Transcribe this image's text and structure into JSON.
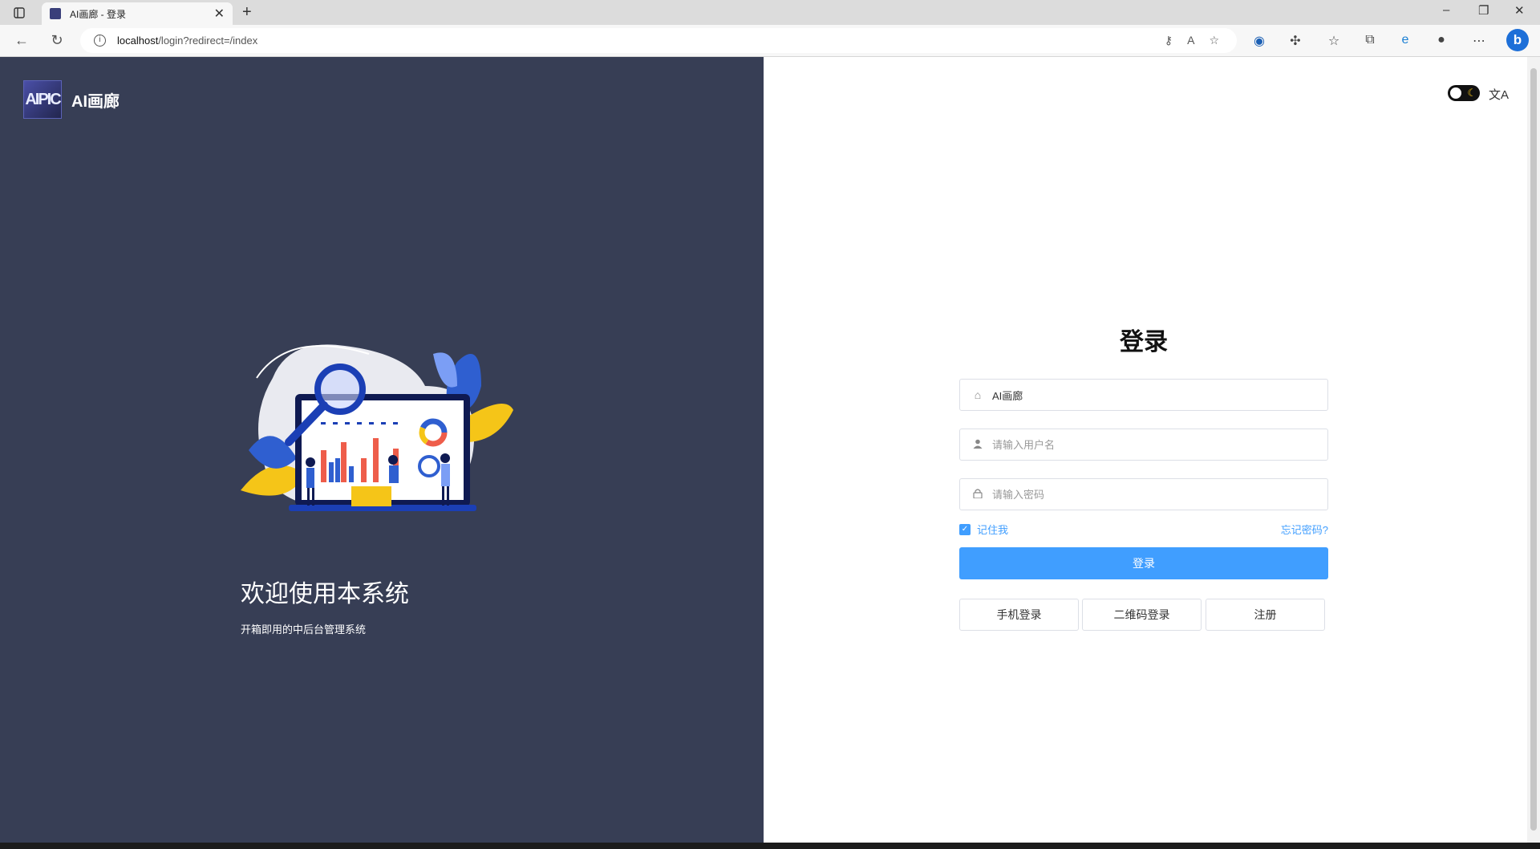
{
  "browser": {
    "tab_title": "AI画廊 - 登录",
    "url_host": "localhost",
    "url_path": "/login?redirect=/index"
  },
  "brand": {
    "logo_text": "AIPIC",
    "name": "AI画廊"
  },
  "left": {
    "welcome": "欢迎使用本系统",
    "subtitle": "开箱即用的中后台管理系统"
  },
  "login": {
    "title": "登录",
    "tenant_value": "AI画廊",
    "username_placeholder": "请输入用户名",
    "password_placeholder": "请输入密码",
    "remember_label": "记住我",
    "remember_checked": true,
    "forgot_label": "忘记密码?",
    "submit_label": "登录",
    "phone_login": "手机登录",
    "qrcode_login": "二维码登录",
    "register": "注册"
  },
  "colors": {
    "sidebar_bg": "#373e55",
    "primary": "#409eff"
  }
}
